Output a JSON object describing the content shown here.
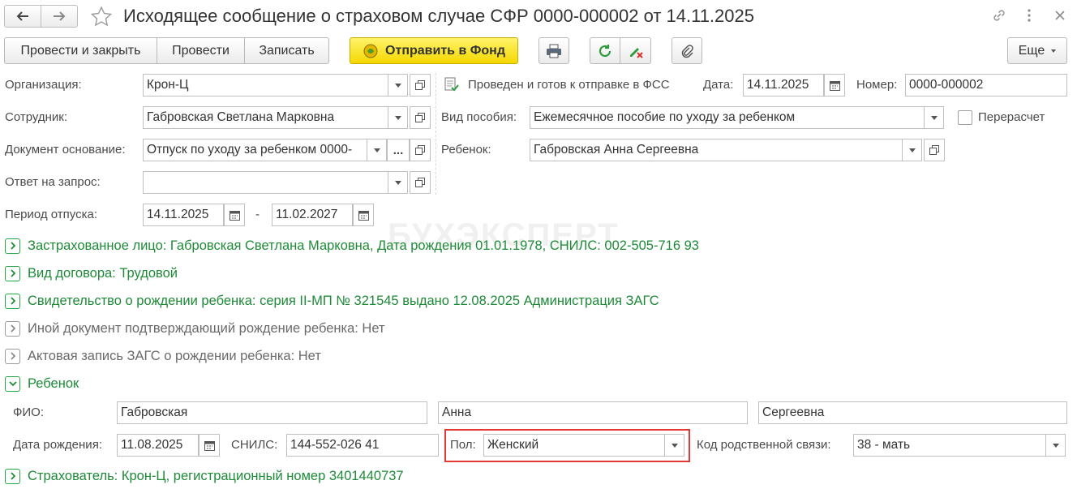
{
  "window": {
    "title": "Исходящее сообщение о страховом случае СФР 0000-000002 от 14.11.2025"
  },
  "toolbar": {
    "post_close_label": "Провести и закрыть",
    "post_label": "Провести",
    "save_label": "Записать",
    "send_label": "Отправить в Фонд",
    "more_label": "Еще"
  },
  "header": {
    "organization_label": "Организация:",
    "organization_value": "Крон-Ц",
    "employee_label": "Сотрудник:",
    "employee_value": "Габровская Светлана Марковна",
    "basis_label": "Документ основание:",
    "basis_value": "Отпуск по уходу за ребенком 0000-",
    "reply_label": "Ответ на запрос:",
    "reply_value": "",
    "period_label": "Период отпуска:",
    "period_from": "14.11.2025",
    "period_dash": "-",
    "period_to": "11.02.2027",
    "status_text": "Проведен и готов к отправке в ФСС",
    "date_label": "Дата:",
    "date_value": "14.11.2025",
    "number_label": "Номер:",
    "number_value": "0000-000002",
    "benefit_label": "Вид пособия:",
    "benefit_value": "Ежемесячное пособие по уходу за ребенком",
    "recalc_label": "Перерасчет",
    "child_label": "Ребенок:",
    "child_value": "Габровская Анна Сергеевна"
  },
  "watermark": "БУХЭКСПЕРТ",
  "groups": {
    "insured": "Застрахованное лицо: Габровская Светлана Марковна, Дата рождения 01.01.1978, СНИЛС: 002-505-716 93",
    "contract": "Вид договора: Трудовой",
    "certificate": "Свидетельство о рождении ребенка: серия II-МП № 321545 выдано 12.08.2025 Администрация ЗАГС",
    "other_doc": "Иной документ подтверждающий рождение ребенка: Нет",
    "act_record": "Актовая запись ЗАГС о рождении ребенка: Нет",
    "child": "Ребенок",
    "insurer": "Страхователь: Крон-Ц, регистрационный номер 3401440737"
  },
  "child_section": {
    "fio_label": "ФИО:",
    "last_name": "Габровская",
    "first_name": "Анна",
    "middle_name": "Сергеевна",
    "birth_label": "Дата рождения:",
    "birth_value": "11.08.2025",
    "snils_label": "СНИЛС:",
    "snils_value": "144-552-026 41",
    "gender_label": "Пол:",
    "gender_value": "Женский",
    "relation_label": "Код родственной связи:",
    "relation_value": "38 - мать"
  },
  "colors": {
    "accent_green": "#1e8a38",
    "send_button": "#f5d800",
    "highlight": "#e53935"
  }
}
